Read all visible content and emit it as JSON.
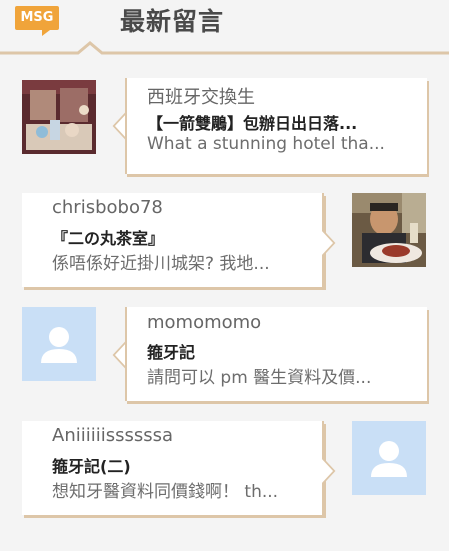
{
  "header": {
    "badge": "MSG",
    "title": "最新留言",
    "colors": {
      "badge": "#f0a43a",
      "rule": "#ddc6a8"
    }
  },
  "comments": [
    {
      "author": "西班牙交換生",
      "title": "【一箭雙鵰】包辦日出日落...",
      "excerpt": "What a stunning hotel tha...",
      "avatar": "photo-shop-window",
      "side": "left"
    },
    {
      "author": "chrisbobo78",
      "title": "『二の丸茶室』",
      "excerpt": "係唔係好近掛川城架? 我地...",
      "avatar": "photo-person-dining",
      "side": "right"
    },
    {
      "author": "momomomo",
      "title": "箍牙記",
      "excerpt": "請問可以 pm 醫生資料及價...",
      "avatar": "default-user-icon",
      "side": "left"
    },
    {
      "author": "Aniiiiiissssssa",
      "title": "箍牙記(二)",
      "excerpt": "想知牙醫資料同價錢啊！ th...",
      "avatar": "default-user-icon",
      "side": "right"
    }
  ]
}
